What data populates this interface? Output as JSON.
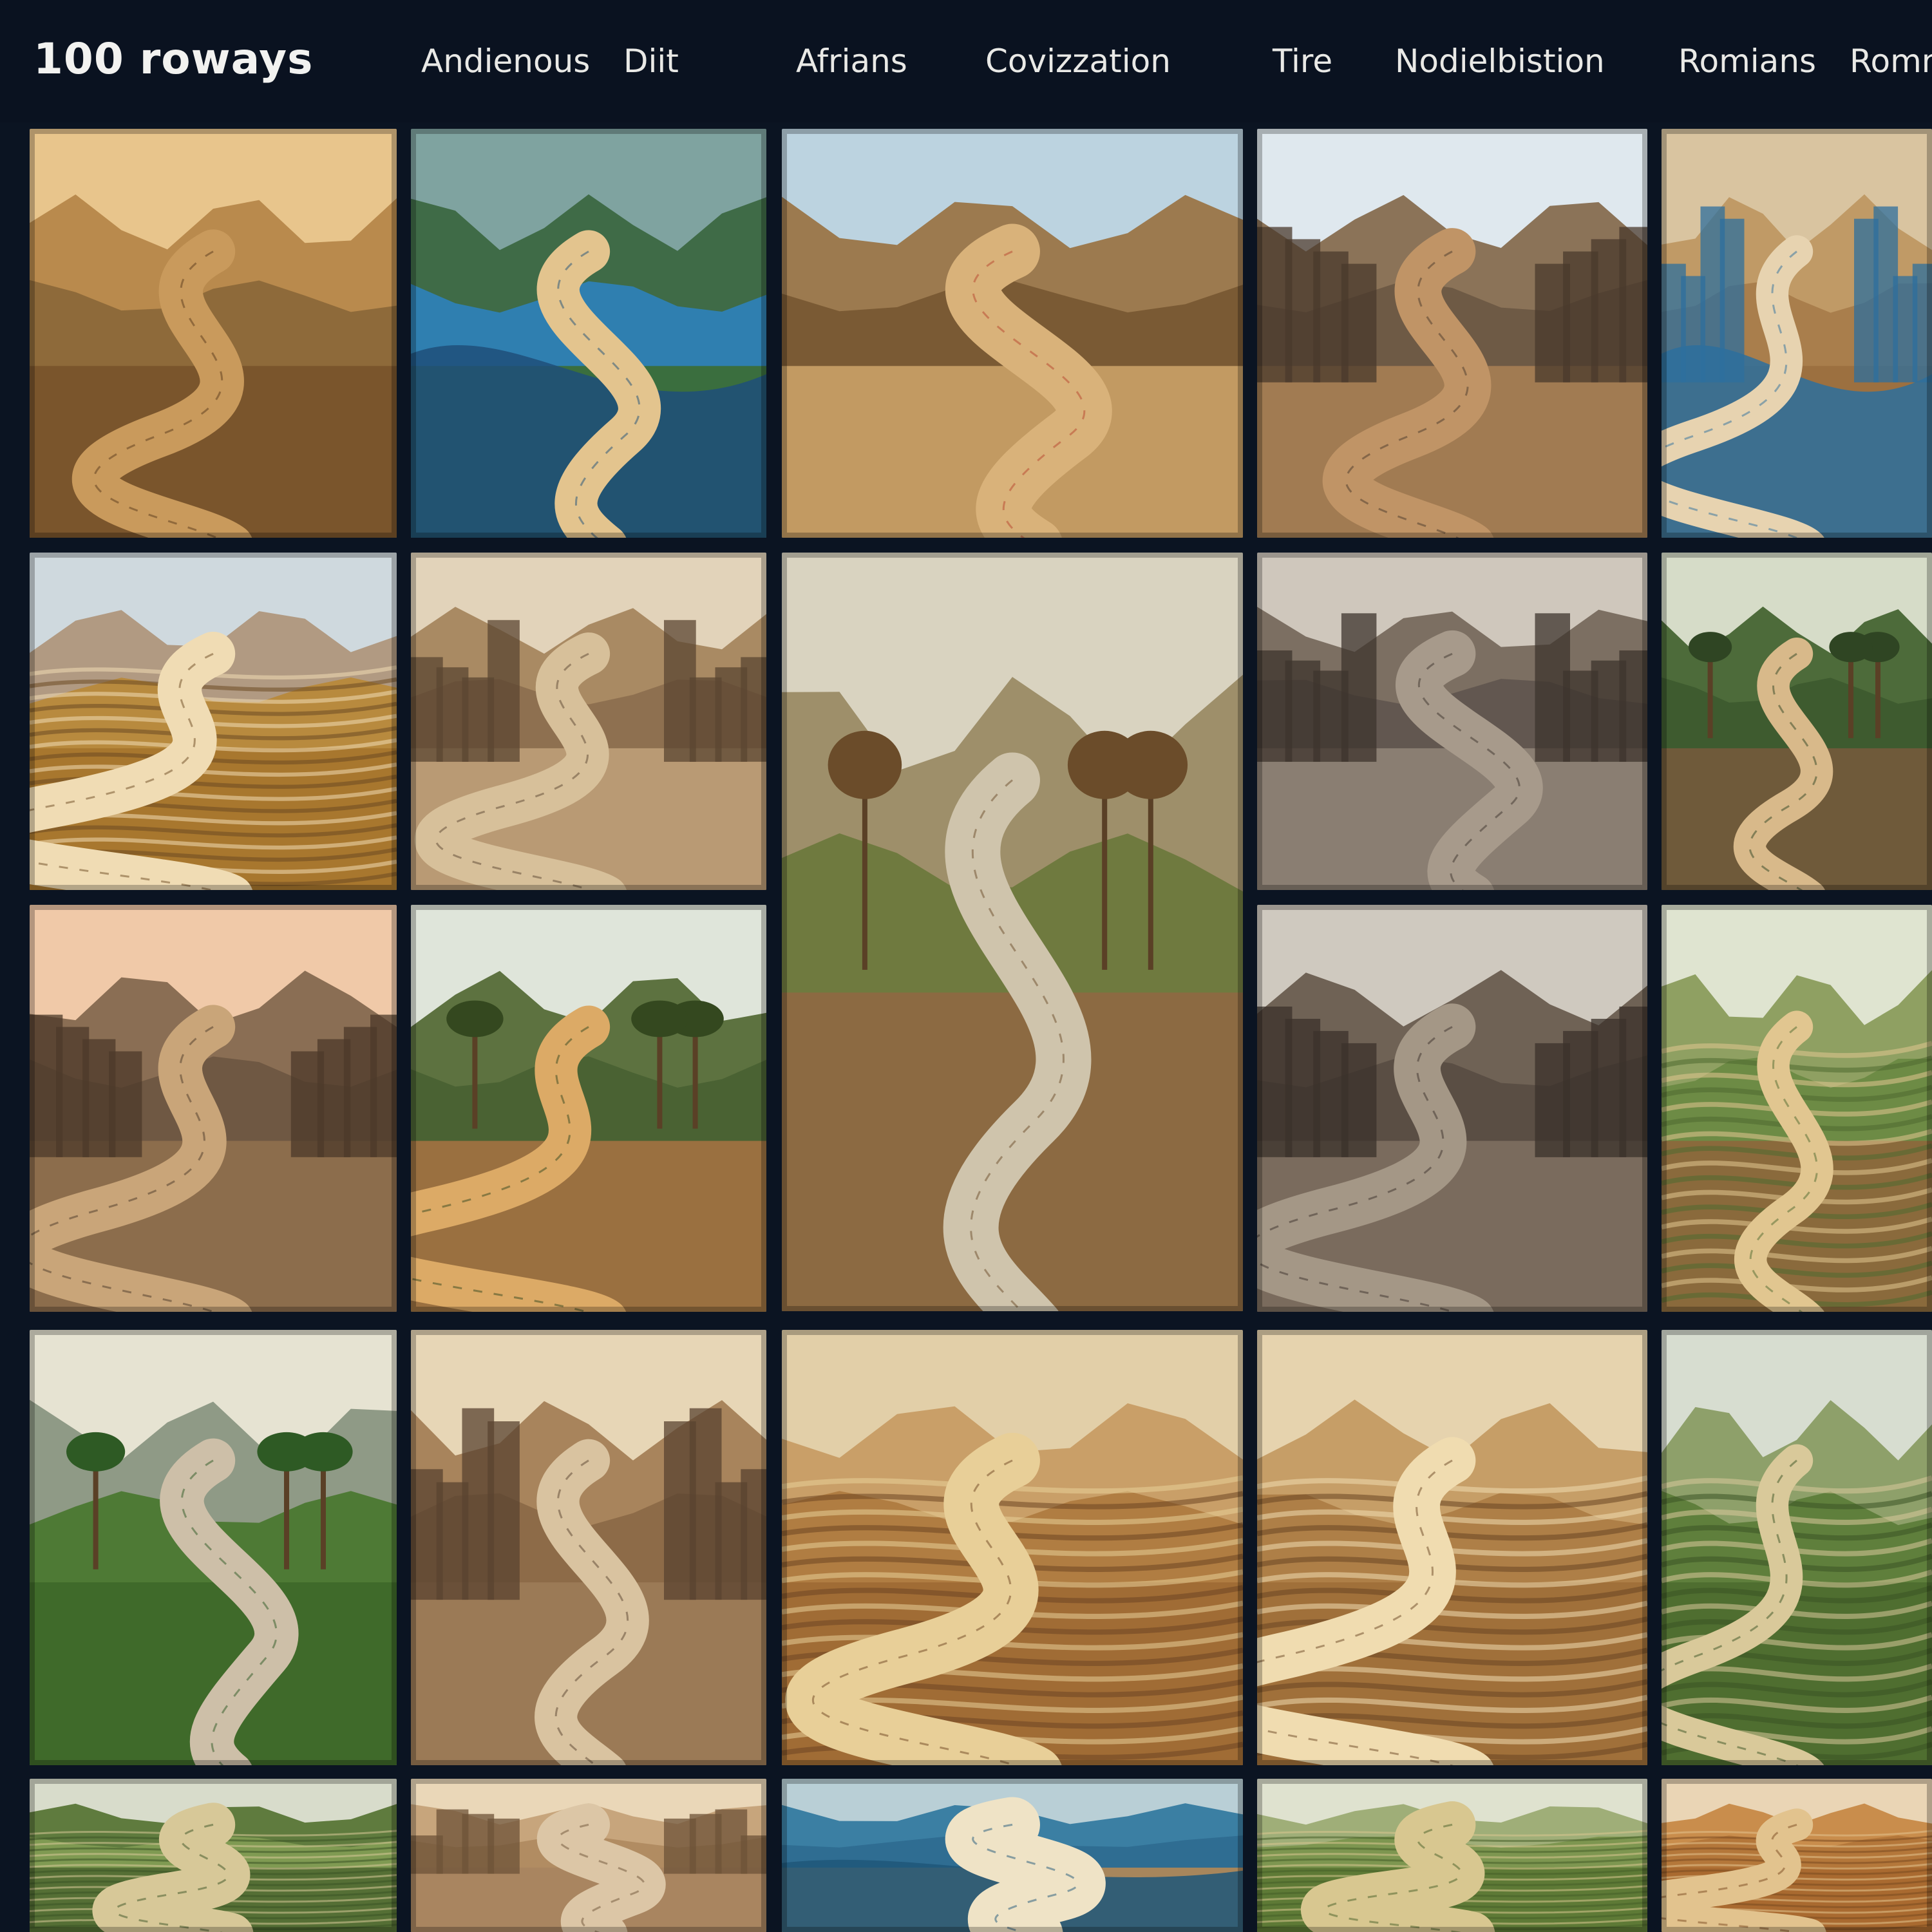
{
  "header": {
    "brand": "100 roways",
    "nav": [
      "Andienous",
      "Diit",
      "Afrians",
      "Covizzation",
      "Tire",
      "Nodielbistion",
      "Romians",
      "Romn"
    ]
  },
  "gallery": {
    "tiles": [
      {
        "theme": "cart-road"
      },
      {
        "theme": "river-road"
      },
      {
        "theme": "truck-road"
      },
      {
        "theme": "city-street"
      },
      {
        "theme": "canyon-river"
      },
      {
        "theme": "field-road"
      },
      {
        "theme": "ruins-road"
      },
      {
        "theme": "palm-road-vehicles"
      },
      {
        "theme": "stone-street"
      },
      {
        "theme": "palm-forest-road"
      },
      {
        "theme": "ancient-city-road"
      },
      {
        "theme": "jungle-road"
      },
      {
        "theme": "carved-street"
      },
      {
        "theme": "terrace-road"
      },
      {
        "theme": "valley-path"
      },
      {
        "theme": "canyon-street"
      },
      {
        "theme": "spiral-dune"
      },
      {
        "theme": "swirl-road"
      },
      {
        "theme": "green-terraces"
      },
      {
        "theme": "terrace-hills"
      },
      {
        "theme": "dusty-canyon"
      },
      {
        "theme": "coast-road"
      },
      {
        "theme": "green-fields"
      },
      {
        "theme": "orange-hills"
      }
    ]
  },
  "colors": {
    "background": "#0b1422",
    "header_text": "#f2f2f0"
  }
}
